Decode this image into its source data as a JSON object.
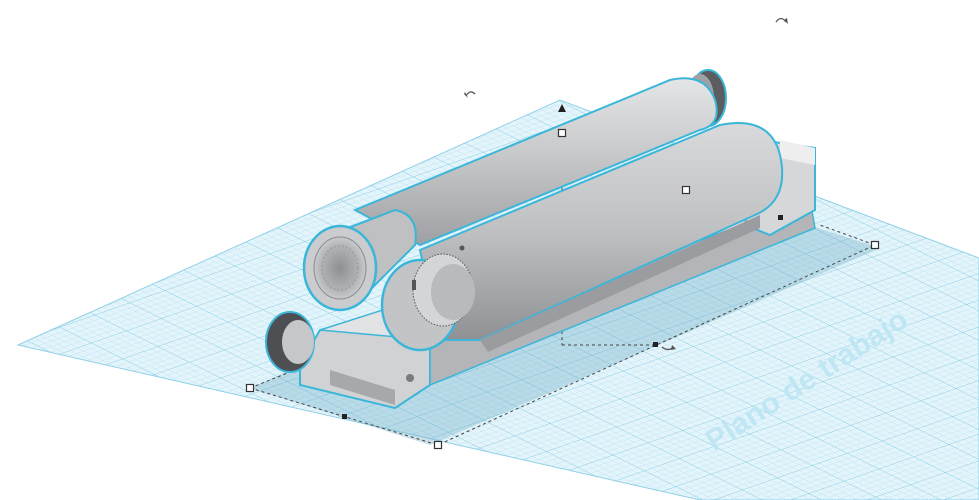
{
  "workplane": {
    "label": "Plano de trabajo",
    "grid_color": "#9fd8ec",
    "fill_color": "#dff2fa"
  },
  "model": {
    "body_color": "#c9cacc",
    "shade_color": "#9c9ea2",
    "outline_color": "#3bb6d9"
  },
  "icons": {
    "rotate": "rotate-arrow-icon",
    "height_arrow": "triangle-up-icon"
  }
}
